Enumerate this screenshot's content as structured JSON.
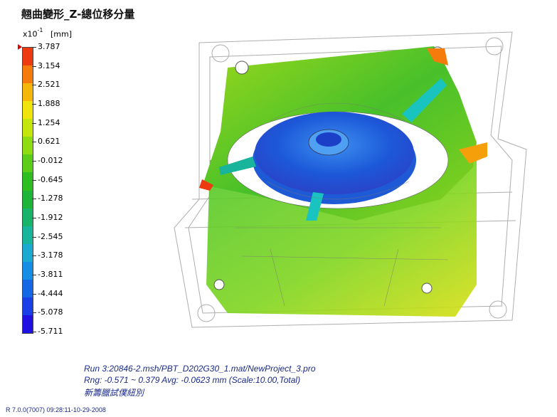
{
  "title": "翹曲變形_Z-總位移分量",
  "unit": {
    "base": "x10",
    "exponent": "-1",
    "label": "[mm]"
  },
  "legend": {
    "labels": [
      "3.787",
      "3.154",
      "2.521",
      "1.888",
      "1.254",
      "0.621",
      "-0.012",
      "-0.645",
      "-1.278",
      "-1.912",
      "-2.545",
      "-3.178",
      "-3.811",
      "-4.444",
      "-5.078",
      "-5.711"
    ],
    "colors": [
      "#ee3a10",
      "#f57c0c",
      "#f5b70a",
      "#efe40c",
      "#c4e60d",
      "#8fdc12",
      "#5ccd18",
      "#2fbe20",
      "#1eb43a",
      "#17b46a",
      "#18b49b",
      "#1caad1",
      "#168ee6",
      "#1468e6",
      "#1a3fe6",
      "#2010e2"
    ],
    "max_marker_color": "#e00000"
  },
  "model": {
    "name": "fan-housing-warpage-3d-model"
  },
  "info": {
    "line1": "Run 3:20846-2.msh/PBT_D202G30_1.mat/NewProject_3.pro",
    "line2": "Rng: -0.571 ~ 0.379   Avg: -0.0623 mm (Scale:10.00,Total)",
    "line3": "新籌臘試僕紐別"
  },
  "footer": "R 7.0.0(7007) 09:28:11-10-29-2008"
}
